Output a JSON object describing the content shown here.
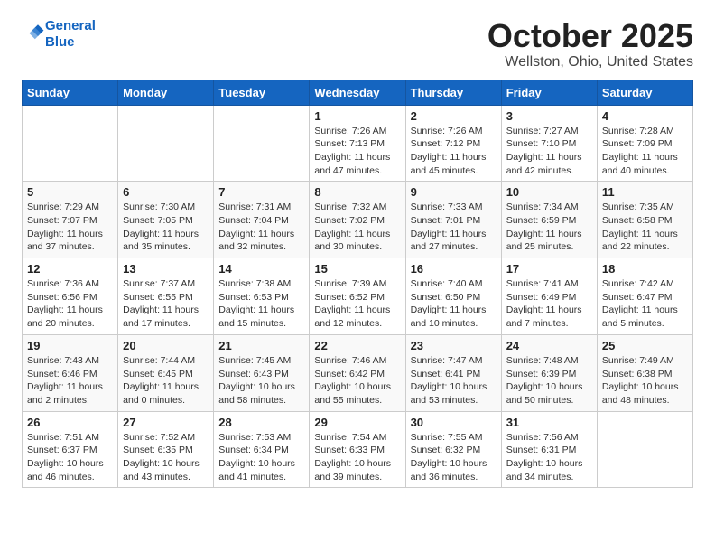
{
  "header": {
    "logo_line1": "General",
    "logo_line2": "Blue",
    "month_title": "October 2025",
    "location": "Wellston, Ohio, United States"
  },
  "days_of_week": [
    "Sunday",
    "Monday",
    "Tuesday",
    "Wednesday",
    "Thursday",
    "Friday",
    "Saturday"
  ],
  "weeks": [
    [
      {
        "day": "",
        "info": ""
      },
      {
        "day": "",
        "info": ""
      },
      {
        "day": "",
        "info": ""
      },
      {
        "day": "1",
        "info": "Sunrise: 7:26 AM\nSunset: 7:13 PM\nDaylight: 11 hours and 47 minutes."
      },
      {
        "day": "2",
        "info": "Sunrise: 7:26 AM\nSunset: 7:12 PM\nDaylight: 11 hours and 45 minutes."
      },
      {
        "day": "3",
        "info": "Sunrise: 7:27 AM\nSunset: 7:10 PM\nDaylight: 11 hours and 42 minutes."
      },
      {
        "day": "4",
        "info": "Sunrise: 7:28 AM\nSunset: 7:09 PM\nDaylight: 11 hours and 40 minutes."
      }
    ],
    [
      {
        "day": "5",
        "info": "Sunrise: 7:29 AM\nSunset: 7:07 PM\nDaylight: 11 hours and 37 minutes."
      },
      {
        "day": "6",
        "info": "Sunrise: 7:30 AM\nSunset: 7:05 PM\nDaylight: 11 hours and 35 minutes."
      },
      {
        "day": "7",
        "info": "Sunrise: 7:31 AM\nSunset: 7:04 PM\nDaylight: 11 hours and 32 minutes."
      },
      {
        "day": "8",
        "info": "Sunrise: 7:32 AM\nSunset: 7:02 PM\nDaylight: 11 hours and 30 minutes."
      },
      {
        "day": "9",
        "info": "Sunrise: 7:33 AM\nSunset: 7:01 PM\nDaylight: 11 hours and 27 minutes."
      },
      {
        "day": "10",
        "info": "Sunrise: 7:34 AM\nSunset: 6:59 PM\nDaylight: 11 hours and 25 minutes."
      },
      {
        "day": "11",
        "info": "Sunrise: 7:35 AM\nSunset: 6:58 PM\nDaylight: 11 hours and 22 minutes."
      }
    ],
    [
      {
        "day": "12",
        "info": "Sunrise: 7:36 AM\nSunset: 6:56 PM\nDaylight: 11 hours and 20 minutes."
      },
      {
        "day": "13",
        "info": "Sunrise: 7:37 AM\nSunset: 6:55 PM\nDaylight: 11 hours and 17 minutes."
      },
      {
        "day": "14",
        "info": "Sunrise: 7:38 AM\nSunset: 6:53 PM\nDaylight: 11 hours and 15 minutes."
      },
      {
        "day": "15",
        "info": "Sunrise: 7:39 AM\nSunset: 6:52 PM\nDaylight: 11 hours and 12 minutes."
      },
      {
        "day": "16",
        "info": "Sunrise: 7:40 AM\nSunset: 6:50 PM\nDaylight: 11 hours and 10 minutes."
      },
      {
        "day": "17",
        "info": "Sunrise: 7:41 AM\nSunset: 6:49 PM\nDaylight: 11 hours and 7 minutes."
      },
      {
        "day": "18",
        "info": "Sunrise: 7:42 AM\nSunset: 6:47 PM\nDaylight: 11 hours and 5 minutes."
      }
    ],
    [
      {
        "day": "19",
        "info": "Sunrise: 7:43 AM\nSunset: 6:46 PM\nDaylight: 11 hours and 2 minutes."
      },
      {
        "day": "20",
        "info": "Sunrise: 7:44 AM\nSunset: 6:45 PM\nDaylight: 11 hours and 0 minutes."
      },
      {
        "day": "21",
        "info": "Sunrise: 7:45 AM\nSunset: 6:43 PM\nDaylight: 10 hours and 58 minutes."
      },
      {
        "day": "22",
        "info": "Sunrise: 7:46 AM\nSunset: 6:42 PM\nDaylight: 10 hours and 55 minutes."
      },
      {
        "day": "23",
        "info": "Sunrise: 7:47 AM\nSunset: 6:41 PM\nDaylight: 10 hours and 53 minutes."
      },
      {
        "day": "24",
        "info": "Sunrise: 7:48 AM\nSunset: 6:39 PM\nDaylight: 10 hours and 50 minutes."
      },
      {
        "day": "25",
        "info": "Sunrise: 7:49 AM\nSunset: 6:38 PM\nDaylight: 10 hours and 48 minutes."
      }
    ],
    [
      {
        "day": "26",
        "info": "Sunrise: 7:51 AM\nSunset: 6:37 PM\nDaylight: 10 hours and 46 minutes."
      },
      {
        "day": "27",
        "info": "Sunrise: 7:52 AM\nSunset: 6:35 PM\nDaylight: 10 hours and 43 minutes."
      },
      {
        "day": "28",
        "info": "Sunrise: 7:53 AM\nSunset: 6:34 PM\nDaylight: 10 hours and 41 minutes."
      },
      {
        "day": "29",
        "info": "Sunrise: 7:54 AM\nSunset: 6:33 PM\nDaylight: 10 hours and 39 minutes."
      },
      {
        "day": "30",
        "info": "Sunrise: 7:55 AM\nSunset: 6:32 PM\nDaylight: 10 hours and 36 minutes."
      },
      {
        "day": "31",
        "info": "Sunrise: 7:56 AM\nSunset: 6:31 PM\nDaylight: 10 hours and 34 minutes."
      },
      {
        "day": "",
        "info": ""
      }
    ]
  ]
}
